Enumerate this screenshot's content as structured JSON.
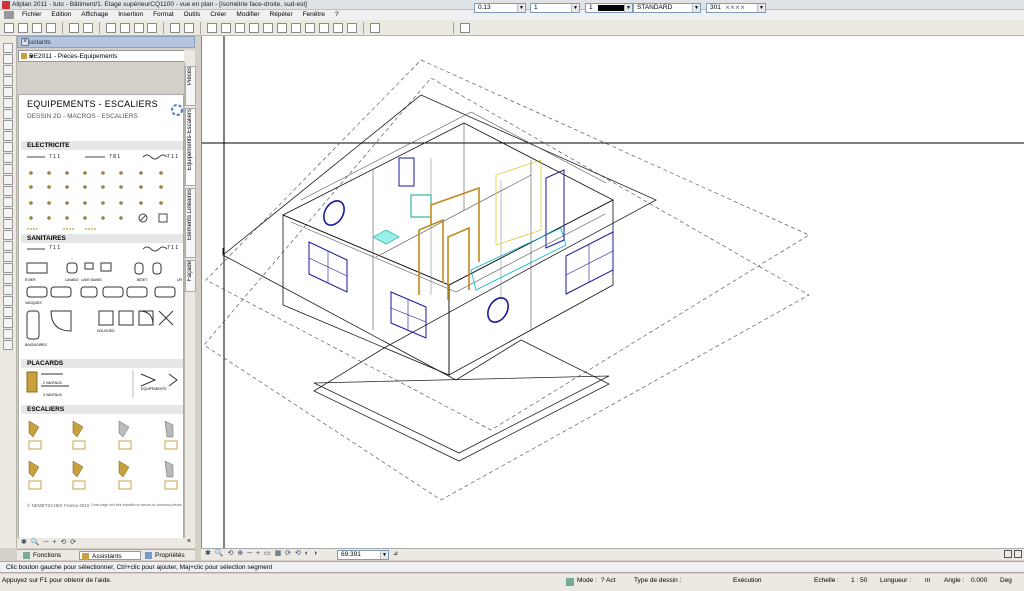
{
  "window": {
    "title": "Allplan 2011 - tuto - Bâtiment/1. Etage supérieurCQ1100 - vue en plan - [Isométrie face-droite, sud-est]"
  },
  "menu": [
    "Fichier",
    "Edition",
    "Affichage",
    "Insertion",
    "Format",
    "Outils",
    "Créer",
    "Modifier",
    "Répéter",
    "Fenêtre",
    "?"
  ],
  "format_bar": {
    "pen": "0.13",
    "line": "1",
    "color": "1",
    "layer": "STANDARD",
    "hatch": "301"
  },
  "panel": {
    "title": "Assistants",
    "dropdown": "DE2011 - Pièces-Equipements",
    "catalog_title": "EQUIPEMENTS - ESCALIERS",
    "catalog_subtitle": "DESSIN 2D - MACROS - ESCALIERS",
    "sections": {
      "electricite": "ELECTRICITE",
      "sanitaires": "SANITAIRES",
      "placards": "PLACARDS",
      "escaliers": "ESCALIERS"
    },
    "elec_labels": [
      "7 1 1",
      "7 8 1",
      "7 1 1"
    ],
    "sanit_labels": [
      "7 1 1",
      "7 1 1"
    ],
    "sanit_items": [
      "EVIER",
      "LAVABO",
      "LAVE MAINS",
      "BIDET",
      "UR"
    ],
    "sanit_row2": [
      "VASQUES"
    ],
    "sanit_row3": [
      "BAIGNOIRES",
      "DOUCHES"
    ],
    "placards_items": [
      "2 VANTAUX",
      "3 VANTAUX",
      "EQUIPEMENTS"
    ],
    "copyright": "© NEMETSCHEK France 2010",
    "copyright_note": "Cette page doit être installée en amont du panneau pièces"
  },
  "side_tabs": [
    "Pièces",
    "Equipements-Escaliers",
    "Eléments Linéaires",
    "Façade"
  ],
  "panel_tabs": [
    "Fonctions",
    "Assistants",
    "Propriétés"
  ],
  "view": {
    "scale_value": "69.391"
  },
  "status": {
    "hint": "Clic bouton gauche pour sélectionner, Ctrl+clic pour ajouter, Maj+clic pour sélection segment",
    "help": "Appuyez sur F1 pour obtenir de l'aide.",
    "mode": "Mode :",
    "mode_value": "? Act",
    "type": "Type de dessin :",
    "execution": "Exécution",
    "scale": "Echelle :",
    "scale_value": "1 : 50",
    "length": "Longueur :",
    "length_unit": "m",
    "angle": "Angle :",
    "angle_value": "0.000",
    "angle_unit": "Deg"
  }
}
